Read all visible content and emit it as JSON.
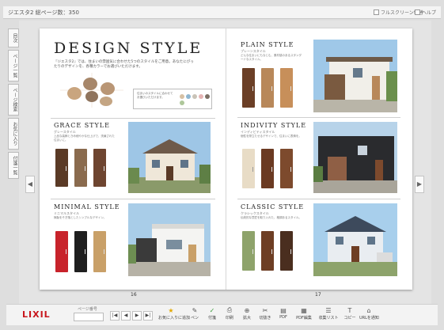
{
  "window": {
    "title": "ジエスタ2  総ページ数：350"
  },
  "topbar": {
    "fullscreen_label": "フルスクリーン切替",
    "help_label": "ヘルプ"
  },
  "side_tabs": [
    "目次",
    "ページ一覧",
    "ページ検索",
    "お気に入り",
    "付箋一覧"
  ],
  "nav": {
    "prev_arrow": "◀",
    "next_arrow": "▶"
  },
  "left_page": {
    "title": "DESIGN STYLE",
    "intro": "『ジエスタ2』では、住まいの雰囲気に合わせた5つのスタイルをご用意。あなたにぴったりのデザインを、各種カラーでお選びいただけます。",
    "chart_caption": "住まいのスタイルに合わせてお選びいただけます。",
    "page_number": "16",
    "sections": [
      {
        "title": "GRACE STYLE",
        "subtitle": "グレースタイル",
        "desc": "上品な装飾ときめ細やかな仕上げで、洗練された住まいに。"
      },
      {
        "title": "MINIMAL STYLE",
        "subtitle": "ミニマルスタイル",
        "desc": "無駄をそぎ落としたシンプルなデザイン。"
      }
    ]
  },
  "right_page": {
    "page_number": "17",
    "sections": [
      {
        "title": "PLAIN STYLE",
        "subtitle": "プレーンスタイル",
        "desc": "どんな住まいにもなじむ、素材感のあるスタンダードなスタイル。"
      },
      {
        "title": "INDIVITY STYLE",
        "subtitle": "インディビティスタイル",
        "desc": "個性を際立たせるデザインで、住まいに表情を。"
      },
      {
        "title": "CLASSIC STYLE",
        "subtitle": "クラシックスタイル",
        "desc": "伝統的な意匠を取り入れた、格調あるスタイル。"
      }
    ]
  },
  "bottombar": {
    "logo": "LIXIL",
    "page_label": "ページ番号",
    "page_value": "",
    "buttons": {
      "first": "|◀",
      "prev": "◀",
      "next": "▶",
      "last": "▶|"
    },
    "tools": [
      {
        "icon": "star-icon",
        "glyph": "★",
        "label": "お気に入りに追加"
      },
      {
        "icon": "pen-icon",
        "glyph": "✎",
        "label": "ペン"
      },
      {
        "icon": "sticky-note-icon",
        "glyph": "✓",
        "label": "付箋"
      },
      {
        "icon": "printer-icon",
        "glyph": "⎙",
        "label": "印刷"
      },
      {
        "icon": "zoom-icon",
        "glyph": "⊕",
        "label": "拡大"
      },
      {
        "icon": "cut-icon",
        "glyph": "✂",
        "label": "切抜き"
      },
      {
        "icon": "pdf-icon",
        "glyph": "▤",
        "label": "PDF"
      },
      {
        "icon": "pdf-edit-icon",
        "glyph": "▦",
        "label": "PDF編集"
      },
      {
        "icon": "list-icon",
        "glyph": "☰",
        "label": "収集リスト"
      },
      {
        "icon": "copy-icon",
        "glyph": "T",
        "label": "コピー"
      },
      {
        "icon": "link-icon",
        "glyph": "⌂",
        "label": "URLを通知"
      }
    ]
  }
}
